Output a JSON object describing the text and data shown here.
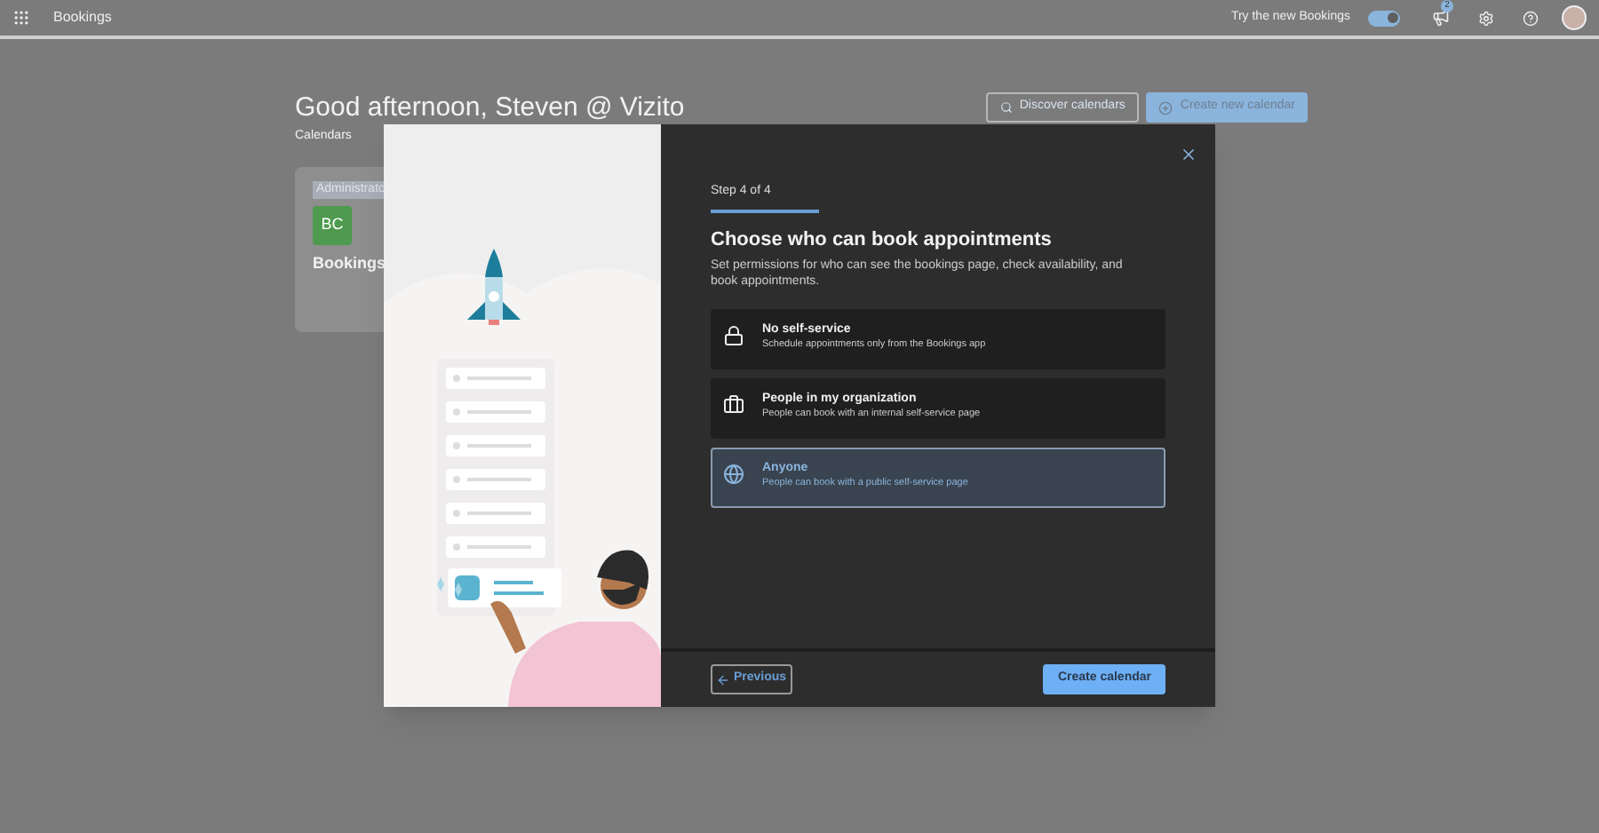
{
  "app_bar": {
    "title": "Bookings",
    "try_new": {
      "label": "Try the new Bookings",
      "on": true
    },
    "notification_count": "2"
  },
  "page": {
    "greeting": "Good afternoon, Steven @ Vizito",
    "subtitle": "Calendars",
    "buttons": [
      {
        "label": "Discover calendars",
        "kind": "search"
      },
      {
        "label": "Create new calendar",
        "kind": "add"
      }
    ],
    "card": {
      "tag": "Administrato",
      "initials": "BC",
      "name": "Bookings"
    }
  },
  "dialog": {
    "step": "Step 4 of 4",
    "progress": {
      "level": 1
    },
    "title": "Choose who can book appointments",
    "description": "Set permissions for who can see the bookings page, check availability, and book appointments.",
    "options": [
      {
        "title": "No self-service",
        "description": "Schedule appointments only from the Bookings app",
        "selected": false
      },
      {
        "title": "People in my organization",
        "description": "People can book with an internal self-service page",
        "selected": false
      },
      {
        "title": "Anyone",
        "description": "People can book with a public self-service page",
        "selected": true
      }
    ],
    "previous": "Previous",
    "create": "Create calendar"
  }
}
